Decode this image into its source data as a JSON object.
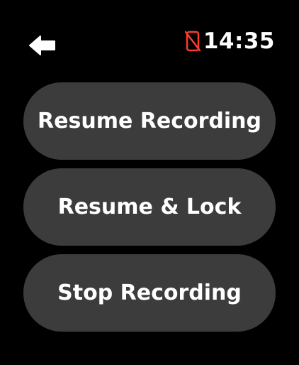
{
  "status": {
    "back_icon": "back-arrow-icon",
    "phone_disconnected_icon": "phone-disconnected-icon",
    "phone_disconnected_color": "#ff3b30",
    "time": "14:35"
  },
  "actions": [
    {
      "label": "Resume Recording"
    },
    {
      "label": "Resume & Lock"
    },
    {
      "label": "Stop Recording"
    }
  ],
  "colors": {
    "background": "#000000",
    "button_background": "#3c3c3c",
    "text": "#ffffff"
  }
}
